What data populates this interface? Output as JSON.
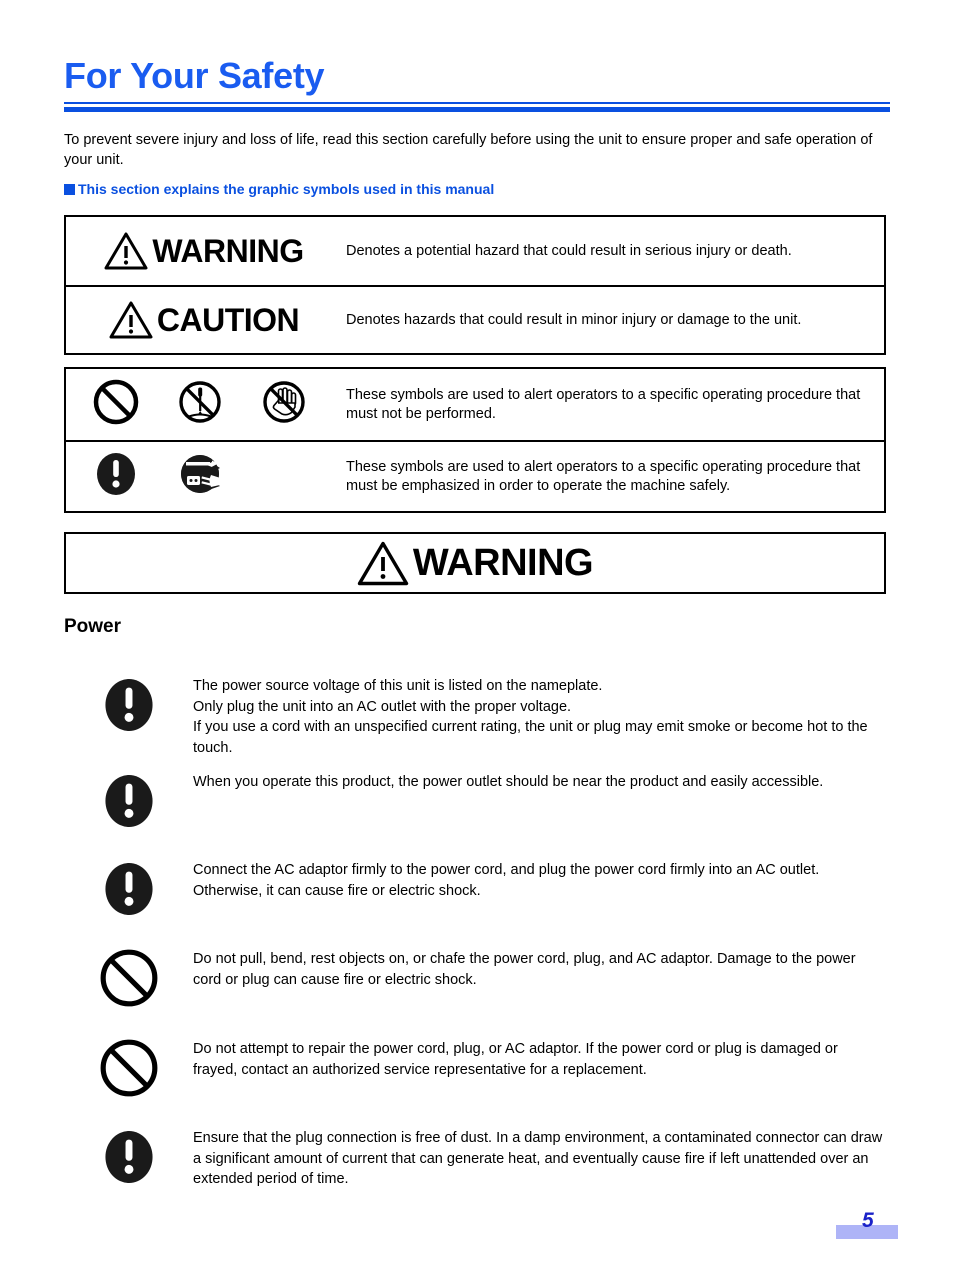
{
  "page": {
    "title": "For Your Safety",
    "intro": "To prevent severe injury and loss of life, read this section carefully before using the unit to ensure proper and safe operation of your unit.",
    "section_note": "This section explains the graphic symbols used in this manual",
    "page_number": "5",
    "accent_blue": "#0a50e0",
    "title_blue": "#1a5cf0",
    "footer_bar_color": "#aeb4f7",
    "footer_number_color": "#1a22c8"
  },
  "warning_caution_table": {
    "rows": [
      {
        "label": "WARNING",
        "icon": "warning-triangle-icon",
        "description": "Denotes a potential hazard that could result in serious injury or death."
      },
      {
        "label": "CAUTION",
        "icon": "warning-triangle-icon",
        "description": "Denotes hazards that could result in minor injury or damage to the unit."
      }
    ]
  },
  "symbols_table": {
    "rows": [
      {
        "icons": [
          "prohibition-circle-icon",
          "no-disassembly-icon",
          "no-touch-hand-icon"
        ],
        "description": "These symbols are used to alert operators to a specific operating procedure that must not be performed."
      },
      {
        "icons": [
          "mandatory-exclamation-icon",
          "unplug-power-icon"
        ],
        "description": "These symbols are used to alert operators to a specific operating procedure that must be emphasized in order to operate the machine safely."
      }
    ]
  },
  "warning_banner": {
    "label": "WARNING",
    "icon": "warning-triangle-icon"
  },
  "power_section": {
    "heading": "Power",
    "items": [
      {
        "icon": "mandatory-exclamation-icon",
        "lines": [
          "The power source voltage of this unit is listed on the nameplate.",
          "Only plug the unit into an AC outlet with the proper voltage.",
          "If you use a cord with an unspecified current rating, the unit or plug may emit smoke or become hot to the touch."
        ]
      },
      {
        "icon": "mandatory-exclamation-icon",
        "lines": [
          "When you operate this product, the power outlet should be near the product and easily accessible."
        ]
      },
      {
        "icon": "mandatory-exclamation-icon",
        "lines": [
          "Connect the AC adaptor firmly to the power cord, and plug the power cord firmly into an AC outlet.",
          "Otherwise, it can cause fire or electric shock."
        ]
      },
      {
        "icon": "prohibition-circle-icon",
        "lines": [
          "Do not pull, bend, rest objects on, or chafe the power cord, plug, and AC adaptor. Damage to the power cord or plug can cause fire or electric shock."
        ]
      },
      {
        "icon": "prohibition-circle-icon",
        "lines": [
          "Do not attempt to repair the power cord, plug, or AC adaptor. If the power cord or plug is damaged or frayed, contact an authorized service representative for a replacement."
        ]
      },
      {
        "icon": "mandatory-exclamation-icon",
        "lines": [
          "Ensure that the plug connection is free of dust. In a damp environment, a contaminated connector can draw a significant amount of current that can generate heat, and eventually cause fire if left unattended over an extended period of time."
        ]
      }
    ]
  }
}
